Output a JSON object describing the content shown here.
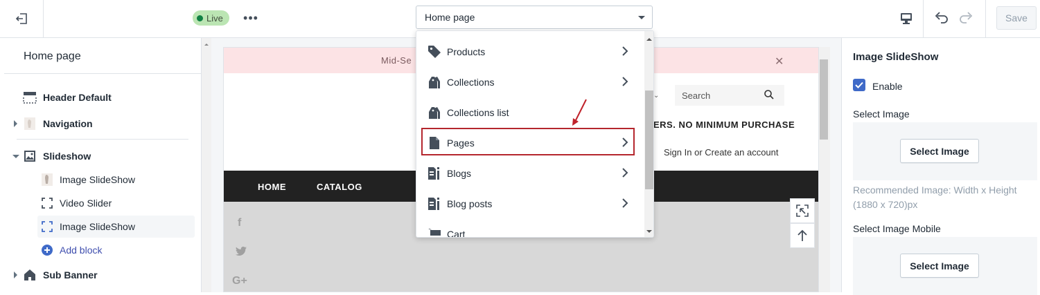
{
  "topbar": {
    "live_label": "Live",
    "more_label": "•••",
    "page_select_value": "Home page",
    "save_label": "Save"
  },
  "sidebar": {
    "title": "Home page",
    "items": [
      {
        "label": "Header Default"
      },
      {
        "label": "Navigation"
      },
      {
        "label": "Slideshow"
      },
      {
        "label": "Image SlideShow"
      },
      {
        "label": "Video Slider"
      },
      {
        "label": "Image SlideShow"
      },
      {
        "label": "Add block"
      },
      {
        "label": "Sub Banner"
      }
    ]
  },
  "preview": {
    "announcement": "Mid-Se",
    "announcement_close": "✕",
    "search_placeholder": "Search",
    "promo_text": "ERS. NO MINIMUM PURCHASE",
    "signin_text": "Sign In or Create an account",
    "nav": {
      "home": "HOME",
      "catalog": "CATALOG"
    },
    "social": [
      "f",
      "t",
      "G+"
    ]
  },
  "dropdown": {
    "items": [
      {
        "label": "Products",
        "icon": "tag-icon"
      },
      {
        "label": "Collections",
        "icon": "collections-icon"
      },
      {
        "label": "Collections list",
        "icon": "collections-list-icon"
      },
      {
        "label": "Pages",
        "icon": "page-icon"
      },
      {
        "label": "Blogs",
        "icon": "blog-icon"
      },
      {
        "label": "Blog posts",
        "icon": "blog-post-icon"
      },
      {
        "label": "Cart",
        "icon": "cart-icon"
      }
    ],
    "highlighted": "Pages"
  },
  "right_panel": {
    "title": "Image SlideShow",
    "enable_label": "Enable",
    "enable_checked": true,
    "select_image_label": "Select Image",
    "select_image_button": "Select Image",
    "recommended_text": "Recommended Image: Width x Height (1880 x 720)px",
    "select_image_mobile_label": "Select Image Mobile",
    "select_image_mobile_button": "Select Image"
  },
  "colors": {
    "live_bg": "#bbe5b3",
    "live_dot": "#108043",
    "highlight_border": "#b4262d",
    "checkbox": "#3f6ac8",
    "announcement_bg": "#fce3e5",
    "navbar_bg": "#222222"
  }
}
